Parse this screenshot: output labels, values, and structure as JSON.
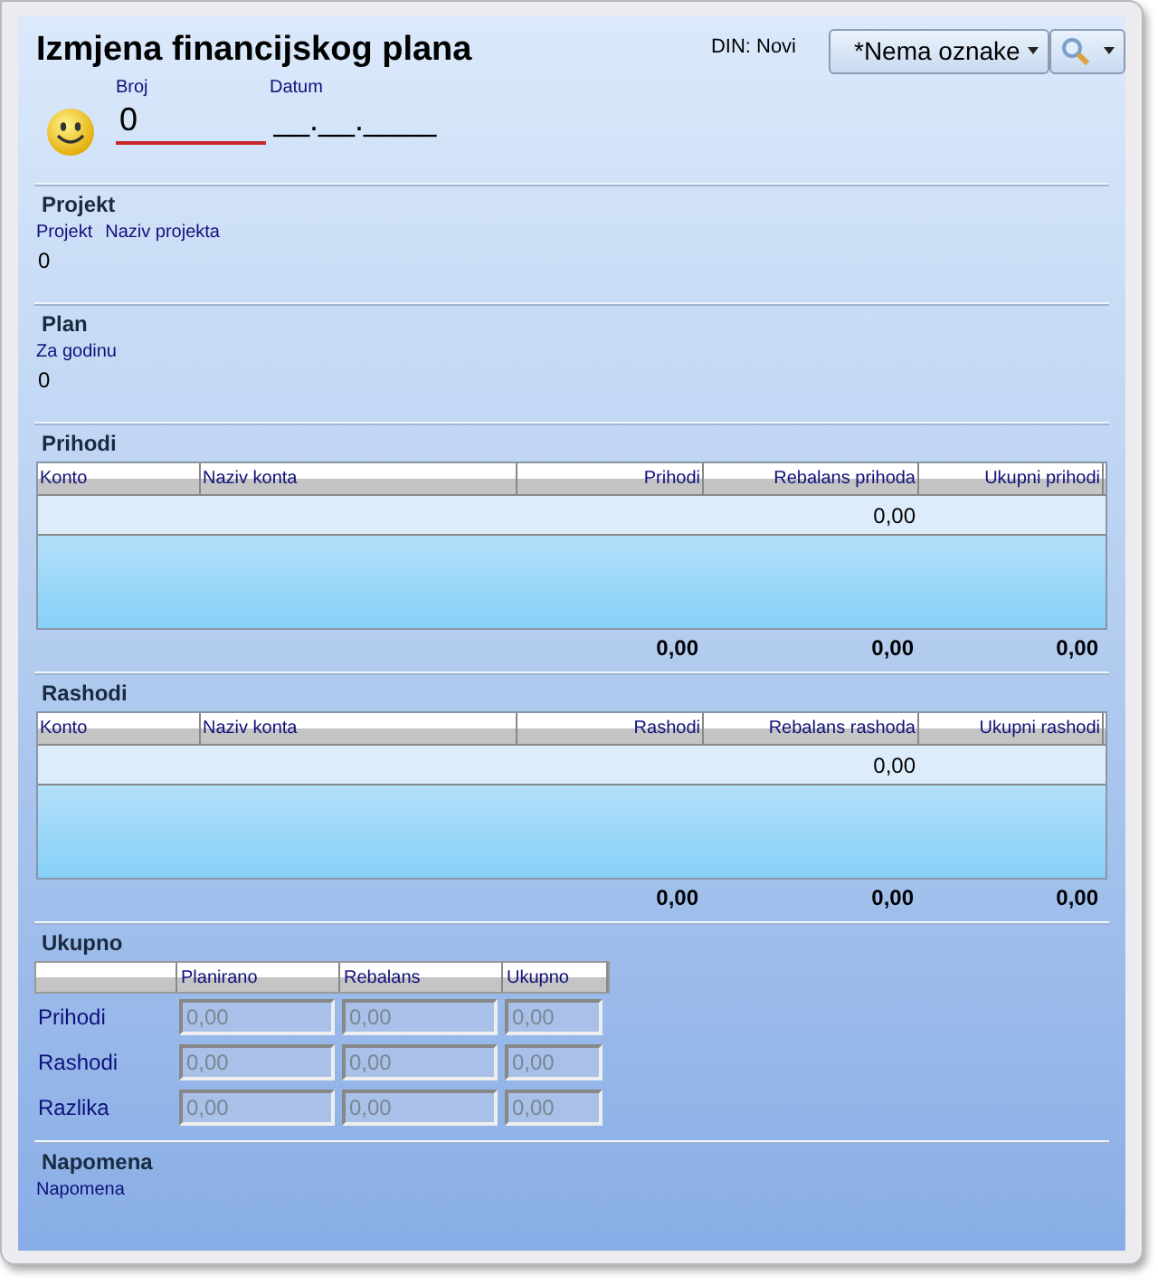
{
  "title": "Izmjena financijskog plana",
  "status": "DIN: Novi",
  "tag_dropdown": {
    "value": "*Nema oznake"
  },
  "header": {
    "broj": {
      "label": "Broj",
      "value": "0"
    },
    "datum": {
      "label": "Datum",
      "value": "__.__.____"
    }
  },
  "projekt": {
    "heading": "Projekt",
    "labels": [
      "Projekt",
      "Naziv projekta"
    ],
    "value": "0"
  },
  "plan": {
    "heading": "Plan",
    "label": "Za godinu",
    "value": "0"
  },
  "tables": [
    {
      "heading": "Prihodi",
      "columns": [
        "Konto",
        "Naziv konta",
        "Prihodi",
        "Rebalans prihoda",
        "Ukupni prihodi"
      ],
      "rows": [
        {
          "rebalance": "0,00"
        }
      ],
      "totals": {
        "amount": "0,00",
        "rebalance": "0,00",
        "total": "0,00"
      }
    },
    {
      "heading": "Rashodi",
      "columns": [
        "Konto",
        "Naziv konta",
        "Rashodi",
        "Rebalans rashoda",
        "Ukupni rashodi"
      ],
      "rows": [
        {
          "rebalance": "0,00"
        }
      ],
      "totals": {
        "amount": "0,00",
        "rebalance": "0,00",
        "total": "0,00"
      }
    }
  ],
  "ukupno": {
    "heading": "Ukupno",
    "columns": [
      "Planirano",
      "Rebalans",
      "Ukupno"
    ],
    "rows": [
      {
        "label": "Prihodi",
        "values": [
          "0,00",
          "0,00",
          "0,00"
        ],
        "disabled": true
      },
      {
        "label": "Rashodi",
        "values": [
          "0,00",
          "0,00",
          "0,00"
        ],
        "disabled": true
      },
      {
        "label": "Razlika",
        "values": [
          "0,00",
          "0,00",
          "0,00"
        ],
        "disabled": true
      }
    ]
  },
  "napomena": {
    "heading": "Napomena",
    "label": "Napomena"
  }
}
